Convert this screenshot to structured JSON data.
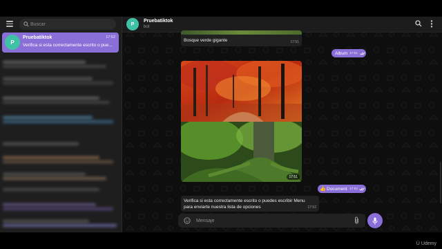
{
  "sidebar": {
    "search_placeholder": "Buscar",
    "active_chat": {
      "avatar_letter": "P",
      "name": "Pruebatiktok",
      "time": "17:52",
      "preview": "Verifica si esta correctamente escrito o pue..."
    }
  },
  "header": {
    "avatar_letter": "P",
    "name": "Pruebatiktok",
    "status": "bot"
  },
  "messages": {
    "caption_in": "Bosque verde gigante",
    "caption_in_time": "17:51",
    "album_out": "Album",
    "album_out_time": "17:51",
    "photos_time": "17:51",
    "document_out": "Document",
    "document_out_time": "17:52",
    "bot_reply": "Verifica si esta correctamente escrito o puedes escribir Menu para enviarte nuestra lista de opciones",
    "bot_reply_time": "17:52"
  },
  "composer": {
    "placeholder": "Mensaje"
  },
  "watermark": "Udemy",
  "colors": {
    "accent": "#8b6fd9",
    "avatar": "#3fc1a6",
    "sidebar_bg": "#1e1e1f",
    "chat_bg": "#0e0e0e"
  },
  "icons": [
    "menu-icon",
    "search-icon",
    "more-icon",
    "emoji-icon",
    "attach-icon",
    "mic-icon",
    "double-check-icon"
  ]
}
